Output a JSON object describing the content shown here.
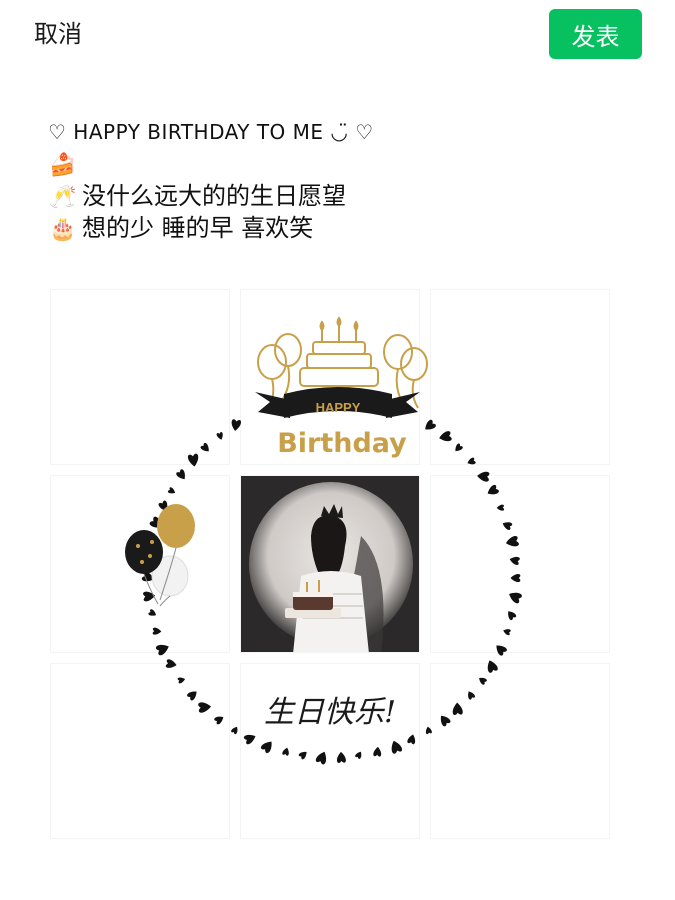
{
  "header": {
    "cancel_label": "取消",
    "publish_label": "发表",
    "publish_color": "#07c160"
  },
  "post": {
    "line1": "♡ HAPPY BIRTHDAY TO ME ◡̈ ♡",
    "line2_emoji": "🍰",
    "line3_emoji": "🥂",
    "line3_text": "没什么远大的的生日愿望",
    "line4_emoji": "🎂",
    "line4_text": "想的少 睡的早 喜欢笑"
  },
  "grid": {
    "images": [
      {
        "name": "grid-image-1",
        "kind": "blank"
      },
      {
        "name": "grid-image-2",
        "kind": "cake-banner"
      },
      {
        "name": "grid-image-3",
        "kind": "blank"
      },
      {
        "name": "grid-image-4",
        "kind": "balloons"
      },
      {
        "name": "grid-image-5",
        "kind": "photo"
      },
      {
        "name": "grid-image-6",
        "kind": "blank"
      },
      {
        "name": "grid-image-7",
        "kind": "blank"
      },
      {
        "name": "grid-image-8",
        "kind": "handwriting"
      },
      {
        "name": "grid-image-9",
        "kind": "blank"
      }
    ],
    "banner_text": "HAPPY",
    "birthday_text": "Birthday",
    "handwriting_text": "生日快乐!",
    "accent_gold": "#c9a04a",
    "heart_color": "#111111"
  }
}
